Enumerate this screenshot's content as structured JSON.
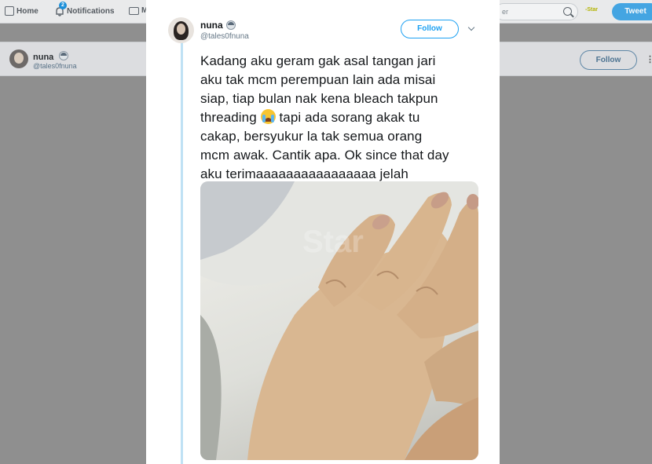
{
  "topnav": {
    "home_label": "Home",
    "notifications_label": "Notifications",
    "notifications_count": "2",
    "messages_label": "M",
    "search_placeholder": "er",
    "logo_text_prefix": "-",
    "logo_text": "Star",
    "tweet_label": "Tweet"
  },
  "profilebar": {
    "name": "nuna",
    "handle": "@tales0fnuna",
    "follow_label": "Follow",
    "more_label": "⋮"
  },
  "tweet": {
    "author_name": "nuna",
    "author_handle": "@tales0fnuna",
    "follow_label": "Follow",
    "lines": [
      "Kadang aku geram gak asal tangan jari",
      "aku tak mcm perempuan lain ada misai",
      "siap, tiap bulan nak kena bleach takpun",
      "threading",
      "tapi ada sorang akak tu",
      "cakap, bersyukur la tak semua orang",
      "mcm awak. Cantik apa. Ok since that day",
      "aku terimaaaaaaaaaaaaaaaa jelah"
    ],
    "inline_emoji": "loudly-crying-face-icon",
    "photo_alt": "hand"
  },
  "colors": {
    "accent": "#1da1f2",
    "thread_line": "#bfe1f4",
    "overlay_bg": "#8f8f8f"
  }
}
